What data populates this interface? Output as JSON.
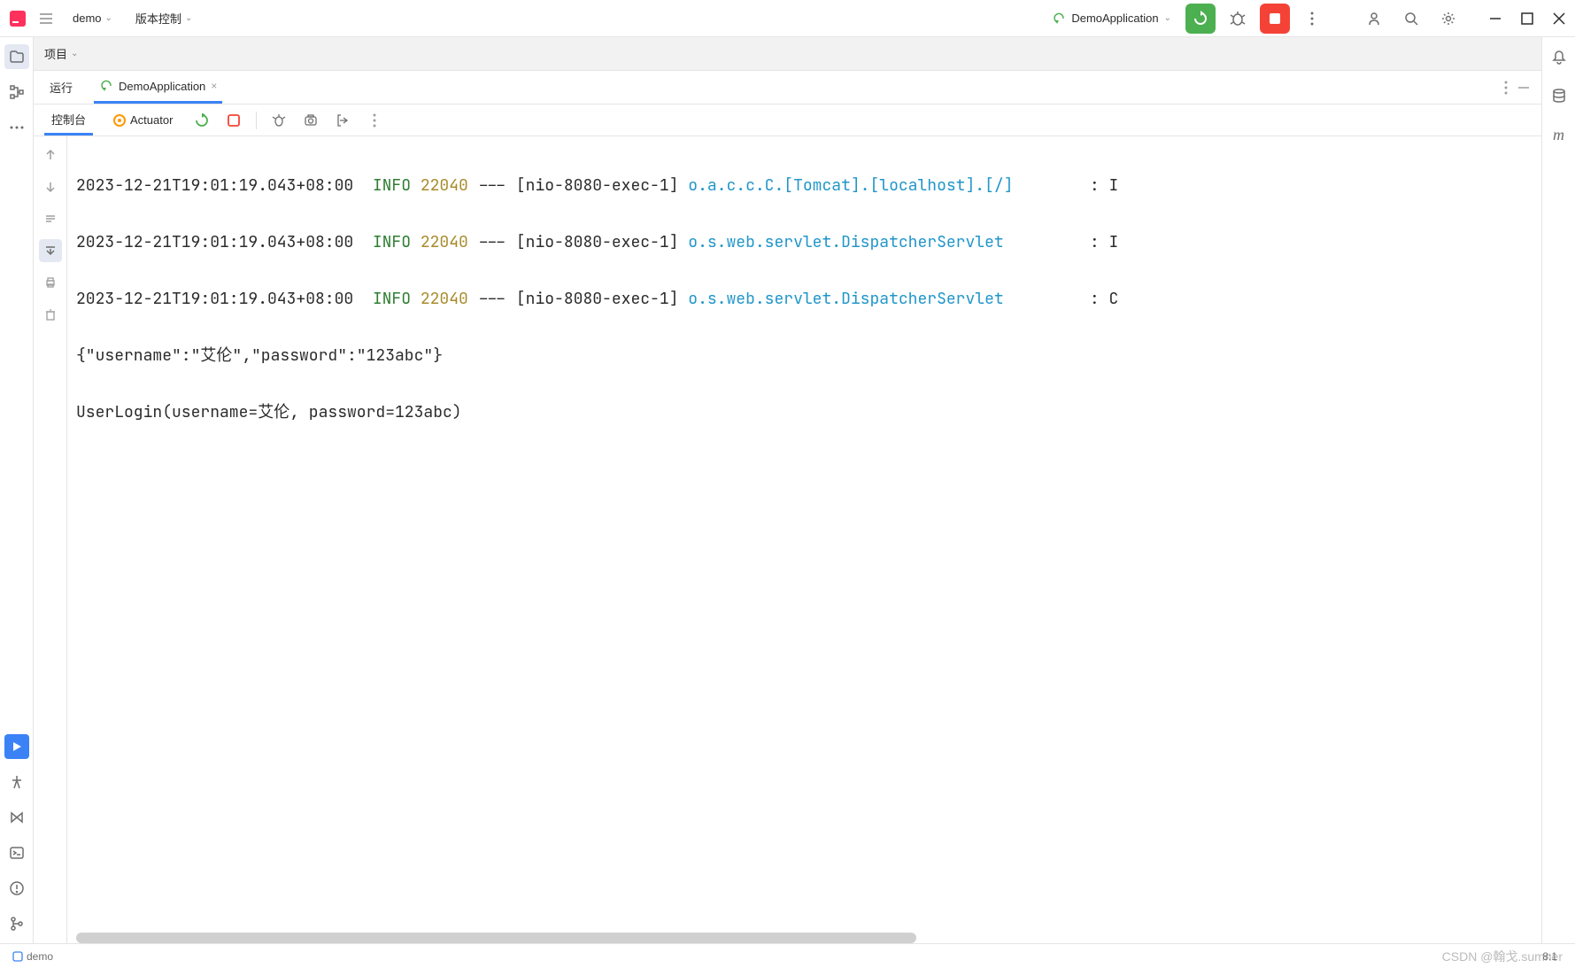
{
  "toolbar": {
    "project_name": "demo",
    "vcs_label": "版本控制",
    "run_config": "DemoApplication"
  },
  "project_panel": {
    "label": "项目"
  },
  "run_panel": {
    "tabs": {
      "run_label": "运行",
      "app_tab_label": "DemoApplication"
    },
    "console_tabs": {
      "console_label": "控制台",
      "actuator_label": "Actuator"
    }
  },
  "console": {
    "lines": [
      {
        "timestamp": "2023-12-21T19:01:19.043+08:00",
        "level": "INFO",
        "pid": "22040",
        "dashes": "---",
        "thread": "[nio-8080-exec-1]",
        "class": "o.a.c.c.C.[Tomcat].[localhost].[/]",
        "tail": ": I"
      },
      {
        "timestamp": "2023-12-21T19:01:19.043+08:00",
        "level": "INFO",
        "pid": "22040",
        "dashes": "---",
        "thread": "[nio-8080-exec-1]",
        "class": "o.s.web.servlet.DispatcherServlet",
        "tail": ": I"
      },
      {
        "timestamp": "2023-12-21T19:01:19.043+08:00",
        "level": "INFO",
        "pid": "22040",
        "dashes": "---",
        "thread": "[nio-8080-exec-1]",
        "class": "o.s.web.servlet.DispatcherServlet",
        "tail": ": C"
      }
    ],
    "plain_lines": [
      "{\"username\":\"艾伦\",\"password\":\"123abc\"}",
      "UserLogin(username=艾伦, password=123abc)"
    ]
  },
  "status": {
    "module_name": "demo",
    "cursor_pos": "8:1"
  },
  "watermark": "CSDN @翰戈.sumner"
}
